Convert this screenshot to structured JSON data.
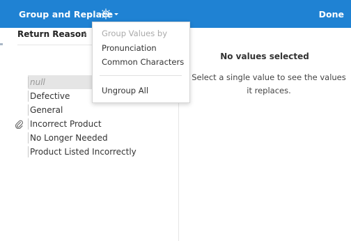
{
  "header": {
    "title": "Group and Replace",
    "done_label": "Done"
  },
  "left_panel": {
    "title": "Return Reason",
    "count": "6",
    "values": [
      {
        "label": "null",
        "is_null": true,
        "selected": true,
        "has_icon": false
      },
      {
        "label": "Defective",
        "is_null": false,
        "has_icon": false
      },
      {
        "label": "General",
        "is_null": false,
        "has_icon": false
      },
      {
        "label": "Incorrect Product",
        "is_null": false,
        "has_icon": true,
        "icon": "paperclip-icon"
      },
      {
        "label": "No Longer Needed",
        "is_null": false,
        "has_icon": false
      },
      {
        "label": "Product Listed Incorrectly",
        "is_null": false,
        "has_icon": false
      }
    ]
  },
  "right_panel": {
    "title": "No values selected",
    "message": "Select a single value to see the values it replaces."
  },
  "menu": {
    "section_label": "Group Values by",
    "items": [
      "Pronunciation",
      "Common Characters"
    ],
    "ungroup_label": "Ungroup All"
  },
  "colors": {
    "header_bg": "#1f82d3",
    "header_text": "#ffffff",
    "null_row_bg": "#e5e5e5"
  }
}
